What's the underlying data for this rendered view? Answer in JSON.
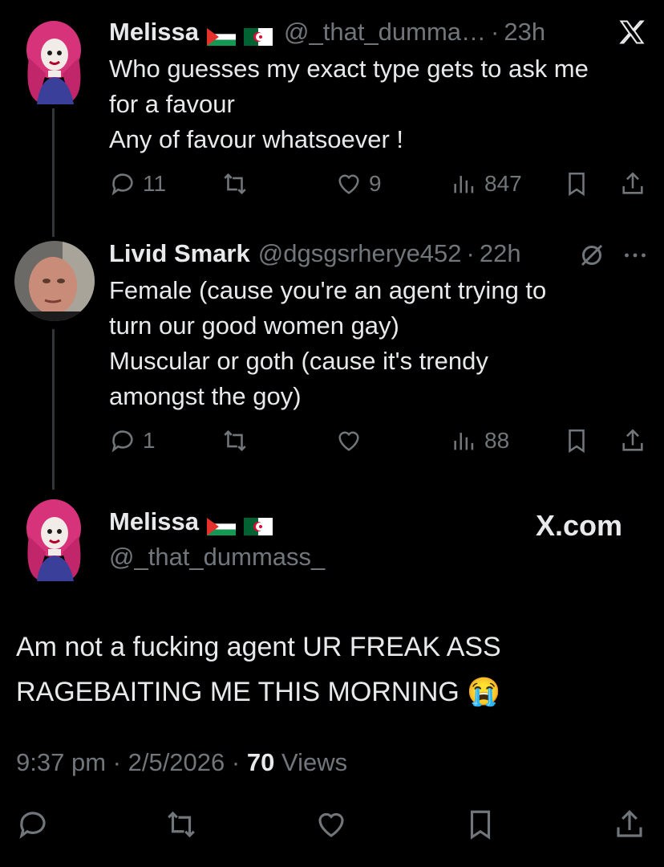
{
  "tweet1": {
    "name": "Melissa",
    "handle": "@_that_dumma…",
    "time": "23h",
    "lines": [
      "Who guesses my exact type gets to ask me",
      "for a favour",
      "Any of favour whatsoever !"
    ],
    "replies": "11",
    "likes": "9",
    "views": "847"
  },
  "tweet2": {
    "name": "Livid Smark",
    "handle": "@dgsgsrherye452",
    "time": "22h",
    "lines": [
      "Female (cause you're an agent trying to",
      "turn our good women gay)",
      "Muscular or goth (cause it's trendy",
      "amongst the goy)"
    ],
    "replies": "1",
    "views": "88"
  },
  "main": {
    "name": "Melissa",
    "handle": "@_that_dummass_",
    "brand": "X.com",
    "lines": [
      "Am not a fucking agent UR FREAK ASS",
      "RAGEBAITING ME THIS MORNING 😭"
    ],
    "time": "9:37 pm",
    "date": "2/5/2026",
    "views_count": "70",
    "views_label": "Views"
  },
  "separator": "·",
  "icons": [
    "reply-icon",
    "repost-icon",
    "like-icon",
    "views-icon",
    "bookmark-icon",
    "share-icon",
    "x-logo-icon",
    "verified-slash-icon",
    "more-icon"
  ],
  "colors": {
    "background": "#000000",
    "text": "#e7e9ea",
    "muted": "#71767b"
  }
}
